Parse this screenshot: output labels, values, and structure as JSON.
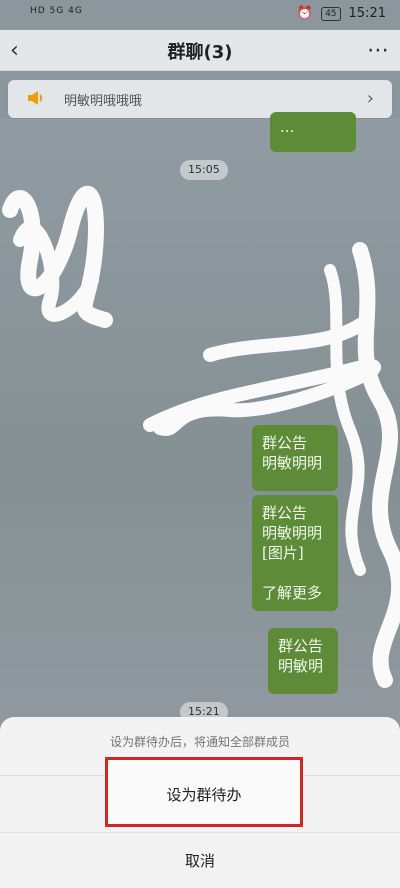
{
  "status": {
    "left": "HD 5G 4G",
    "battery": "45",
    "time": "15:21"
  },
  "header": {
    "title": "群聊(3)"
  },
  "notice": {
    "text": "明敏明哦哦哦"
  },
  "chat": {
    "time_1": "15:05",
    "bubble_top_right": "...",
    "bubble_1": "群公告\n明敏明明",
    "bubble_2": "群公告\n明敏明明\n[图片]\n\n了解更多",
    "bubble_3": "群公告\n明敏明",
    "time_2": "15:21"
  },
  "sheet": {
    "hint": "设为群待办后，将通知全部群成员",
    "primary": "设为群待办",
    "cancel": "取消"
  },
  "colors": {
    "accent_red": "#d52727",
    "bubble_green": "#5f8e3a"
  }
}
